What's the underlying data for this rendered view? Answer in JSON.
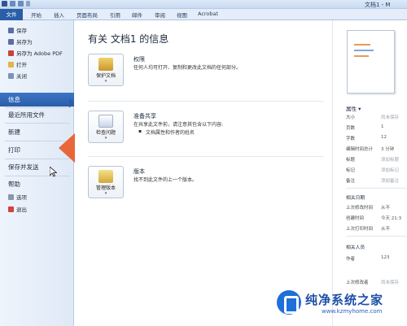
{
  "window": {
    "title": "文档1 - M"
  },
  "ribbon": {
    "file_tab": "文件",
    "tabs": [
      "开始",
      "插入",
      "页面布局",
      "引用",
      "邮件",
      "审阅",
      "视图",
      "Acrobat"
    ]
  },
  "backstage": {
    "commands": [
      {
        "label": "保存",
        "icon": "save-icon"
      },
      {
        "label": "另存为",
        "icon": "save-as-icon"
      },
      {
        "label": "另存为 Adobe PDF",
        "icon": "pdf-icon"
      },
      {
        "label": "打开",
        "icon": "open-folder-icon"
      },
      {
        "label": "关闭",
        "icon": "close-document-icon"
      }
    ],
    "sections": {
      "info": "信息",
      "recent": "最近所用文件",
      "new": "新建",
      "print": "打印",
      "share": "保存并发送",
      "help": "帮助"
    },
    "bottom": [
      {
        "label": "选项",
        "icon": "options-icon"
      },
      {
        "label": "退出",
        "icon": "exit-icon"
      }
    ]
  },
  "info": {
    "title": "有关 文档1 的信息",
    "permissions": {
      "button": "保护文档",
      "title": "权限",
      "desc": "任何人均可打开、复制和更改此文档的任何部分。"
    },
    "prepare": {
      "button": "检查问题",
      "title": "准备共享",
      "desc": "在共享此文件前，请注意其包含以下内容:",
      "bullet": "文档属性和作者的姓名"
    },
    "versions": {
      "button": "管理版本",
      "title": "版本",
      "desc": "找不到此文件的上一个版本。"
    }
  },
  "properties": {
    "title": "属性",
    "rows": [
      {
        "key": "大小",
        "value": "尚未保存",
        "muted": true
      },
      {
        "key": "页数",
        "value": "1",
        "muted": false
      },
      {
        "key": "字数",
        "value": "12",
        "muted": false
      },
      {
        "key": "编辑时间总计",
        "value": "3 分钟",
        "muted": false
      },
      {
        "key": "标题",
        "value": "添加标题",
        "muted": true
      },
      {
        "key": "标记",
        "value": "添加标记",
        "muted": true
      },
      {
        "key": "备注",
        "value": "添加备注",
        "muted": true
      }
    ],
    "dates_title": "相关日期",
    "dates": [
      {
        "key": "上次修改时间",
        "value": "从不"
      },
      {
        "key": "创建时间",
        "value": "今天 21:3"
      },
      {
        "key": "上次打印时间",
        "value": "从不"
      }
    ],
    "people_title": "相关人员",
    "people": [
      {
        "key": "作者",
        "value": "123"
      },
      {
        "key": "上次修改者",
        "value": "尚未保存"
      }
    ]
  },
  "watermark": {
    "name": "纯净系统之家",
    "url": "www.kzmyhome.com"
  },
  "colors": {
    "file_tab": "#2a5ea8",
    "arrow": "#e8663a",
    "accent": "#1e6fd9"
  }
}
